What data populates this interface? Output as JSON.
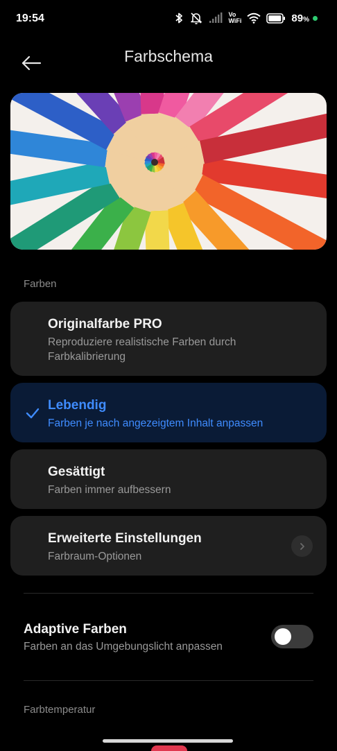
{
  "status_bar": {
    "time": "19:54",
    "battery_percent": "89",
    "percent_sign": "%",
    "volte_top": "Vo",
    "volte_bottom": "WiFi",
    "icons": [
      "bluetooth-icon",
      "mute-icon",
      "signal-icon",
      "vowifi-icon",
      "wifi-icon",
      "battery-icon",
      "charging-dot"
    ],
    "charge_color": "#2ecc71"
  },
  "header": {
    "title": "Farbschema",
    "back_icon": "back-arrow-icon"
  },
  "sections": {
    "colors_label": "Farben",
    "temperature_label": "Farbtemperatur"
  },
  "options": [
    {
      "title": "Originalfarbe PRO",
      "subtitle": "Reproduziere realistische Farben durch Farbkalibrierung",
      "selected": false
    },
    {
      "title": "Lebendig",
      "subtitle": "Farben je nach angezeigtem Inhalt anpassen",
      "selected": true
    },
    {
      "title": "Gesättigt",
      "subtitle": "Farben immer aufbessern",
      "selected": false
    },
    {
      "title": "Erweiterte Einstellungen",
      "subtitle": "Farbraum-Optionen",
      "selected": false
    }
  ],
  "adaptive": {
    "title": "Adaptive Farben",
    "subtitle": "Farben an das Umgebungslicht anpassen",
    "enabled": false
  },
  "colors": {
    "accent": "#3f8cff",
    "card": "#1f1f1f",
    "card_selected": "#0a1b36"
  }
}
